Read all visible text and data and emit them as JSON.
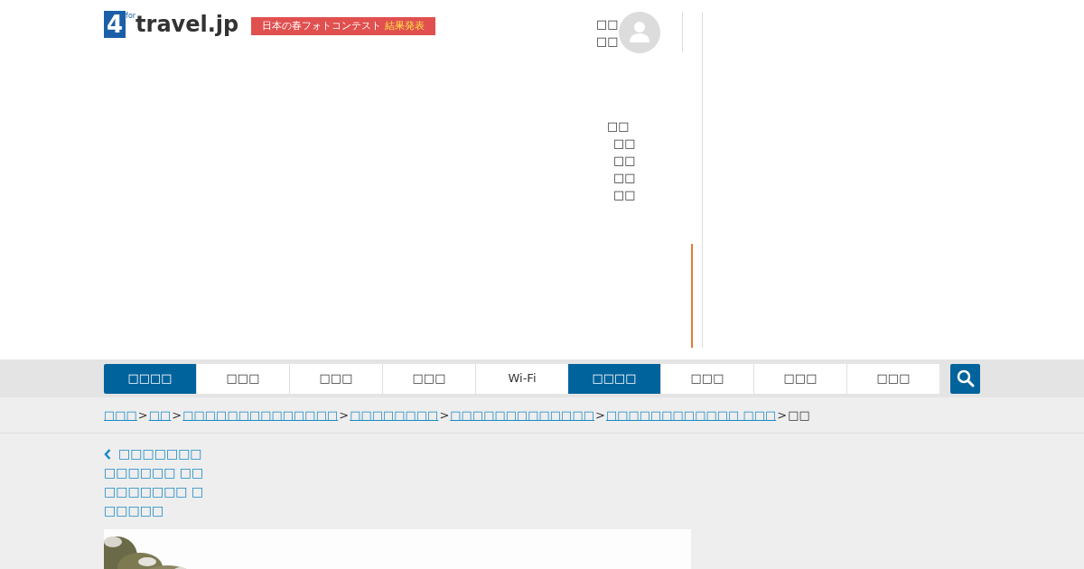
{
  "logo": {
    "text": "travel.jp",
    "mark": "4",
    "sub": "for"
  },
  "banner": {
    "text": "日本の春フォトコンテスト",
    "highlight": "結果発表"
  },
  "user": {
    "lines": [
      "□□",
      "□□"
    ]
  },
  "menu": {
    "heading": "□□",
    "items": [
      "□□",
      "□□",
      "□□",
      "□□"
    ]
  },
  "nav": {
    "tabs": [
      {
        "label": "□□□□",
        "selected": true
      },
      {
        "label": "□□□",
        "selected": false
      },
      {
        "label": "□□□",
        "selected": false
      },
      {
        "label": "□□□",
        "selected": false
      },
      {
        "label": "Wi-Fi",
        "selected": false
      },
      {
        "label": "□□□□",
        "selected": true
      },
      {
        "label": "□□□",
        "selected": false
      },
      {
        "label": "□□□",
        "selected": false
      },
      {
        "label": "□□□",
        "selected": false
      }
    ]
  },
  "breadcrumb": [
    {
      "label": "□□□",
      "link": true
    },
    {
      "separator": ">",
      "label": "□□",
      "link": true
    },
    {
      "separator": ">",
      "label": "□□□□□□□□□□□□□□",
      "link": true
    },
    {
      "separator": ">",
      "label": "□□□□□□□□",
      "link": true
    },
    {
      "separator": ">",
      "label": "□□□□□□□□□□□□□",
      "link": true
    },
    {
      "separator": ">",
      "label": "□□□□□□□□□□□□ □□□",
      "link": true
    },
    {
      "separator": ">",
      "label": "□□",
      "link": false
    }
  ],
  "back_link": "□□□□□□□",
  "title_lines": [
    "□□□□□□ □□",
    "□□□□□□□ □",
    "□□□□□"
  ],
  "photo": {
    "kind": "picture"
  }
}
